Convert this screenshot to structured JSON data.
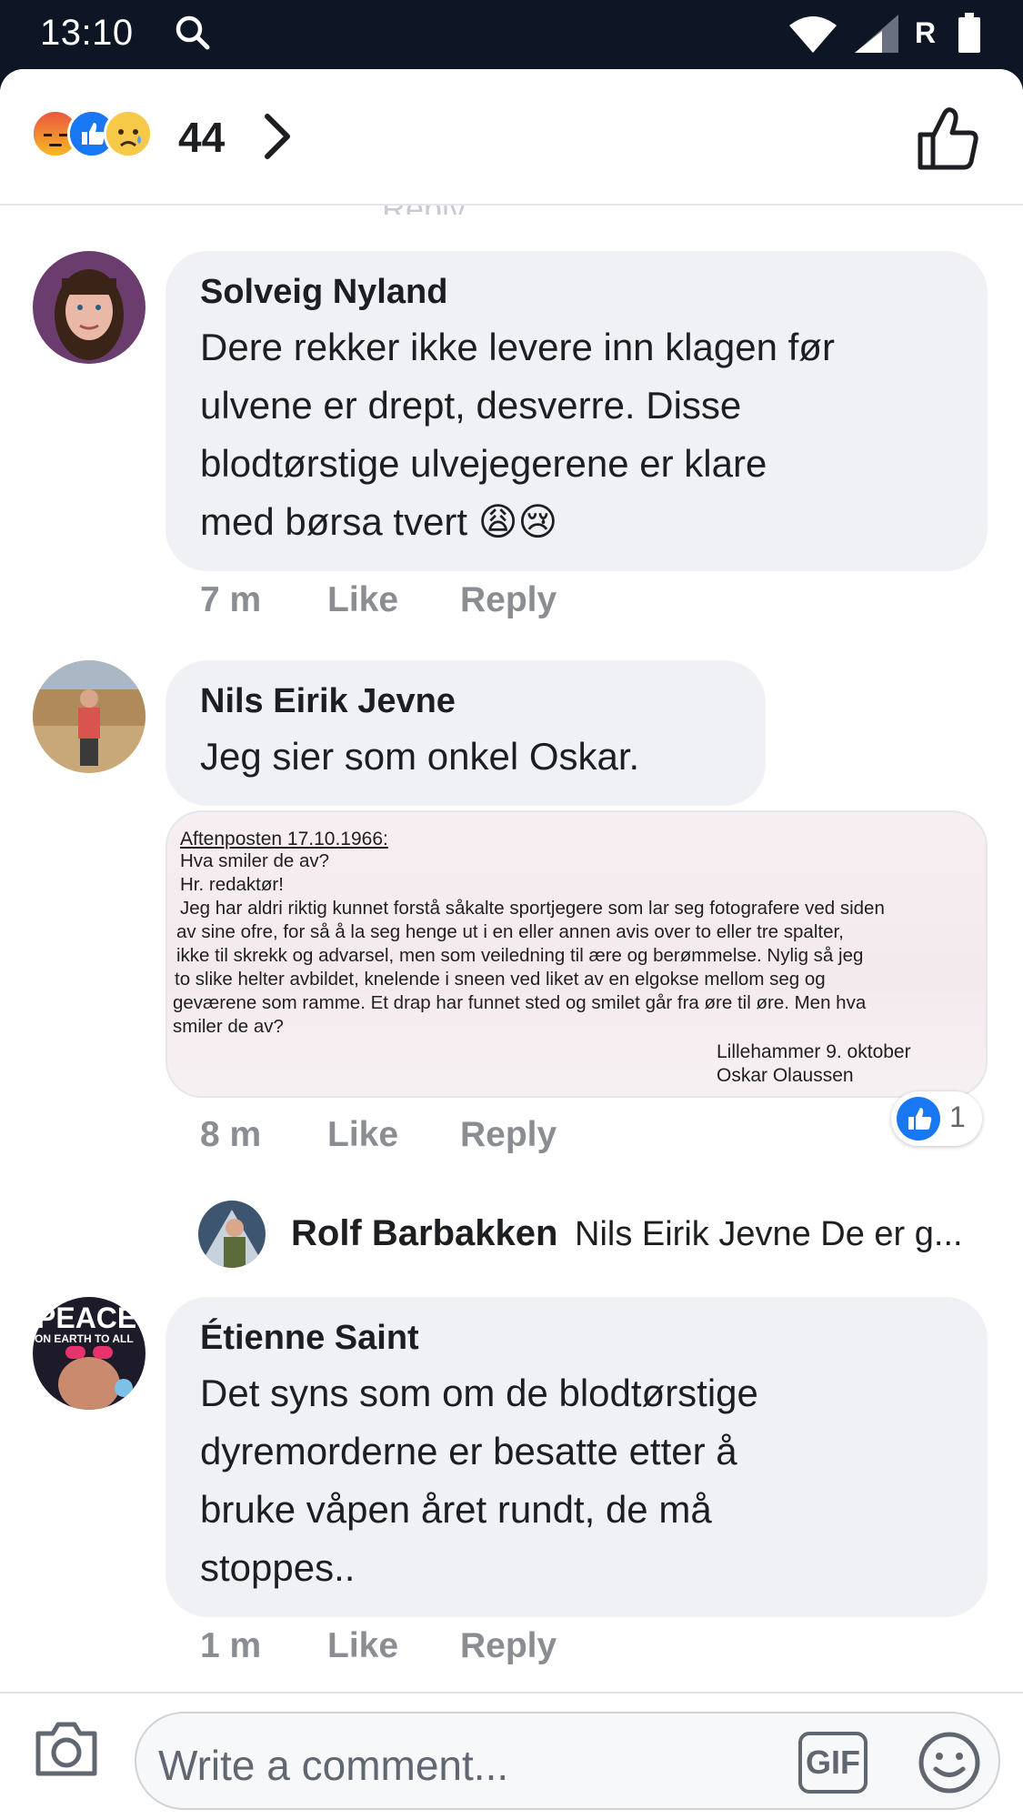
{
  "status_bar": {
    "time": "13:10",
    "carrier": "R"
  },
  "reactions": {
    "count": "44",
    "icons": [
      "angry-emoji",
      "like-emoji",
      "sad-emoji"
    ]
  },
  "comments": [
    {
      "author": "Solveig Nyland",
      "text_lines": [
        "Dere rekker ikke levere inn klagen før",
        "ulvene er drept, desverre. Disse",
        "blodtørstige ulvejegerene er klare",
        "med børsa tvert 😩😢"
      ],
      "time": "7 m",
      "like": "Like",
      "reply": "Reply"
    },
    {
      "author": "Nils Eirik Jevne",
      "text_lines": [
        "Jeg sier som onkel Oskar."
      ],
      "image_text": {
        "heading": "Aftenposten 17.10.1966:",
        "lines": [
          "Hva smiler de av?",
          "Hr. redaktør!",
          "Jeg har aldri riktig kunnet forstå såkalte sportjegere som lar seg fotografere ved siden",
          "av sine ofre, for så å la seg henge ut i en eller annen avis over to eller tre spalter,",
          "ikke til skrekk og advarsel, men som veiledning til ære og berømmelse.  Nylig så jeg",
          "to slike helter avbildet, knelende i sneen ved liket av en elgokse mellom seg og",
          "geværene som ramme.  Et drap har funnet sted og smilet går fra øre til øre.  Men hva",
          "smiler de av?"
        ],
        "signature": [
          "Lillehammer 9. oktober",
          "Oskar Olaussen"
        ]
      },
      "time": "8 m",
      "like": "Like",
      "reply": "Reply",
      "like_count": "1",
      "reply_preview": {
        "author": "Rolf Barbakken",
        "text": "Nils Eirik Jevne De er g..."
      }
    },
    {
      "author": "Étienne Saint",
      "text_lines": [
        "Det syns som om de blodtørstige",
        "dyremorderne er besatte etter å",
        "bruke våpen året rundt, de må",
        "stoppes.."
      ],
      "avatar_text": [
        "PEACE",
        "ON EARTH TO ALL"
      ],
      "time": "1 m",
      "like": "Like",
      "reply": "Reply"
    }
  ],
  "ghost_reply": "Reply",
  "composer": {
    "placeholder": "Write a comment...",
    "gif_label": "GIF"
  },
  "colors": {
    "like_blue": "#1877f2",
    "meta_gray": "#8a8d91",
    "bubble_bg": "#eff1f4"
  }
}
